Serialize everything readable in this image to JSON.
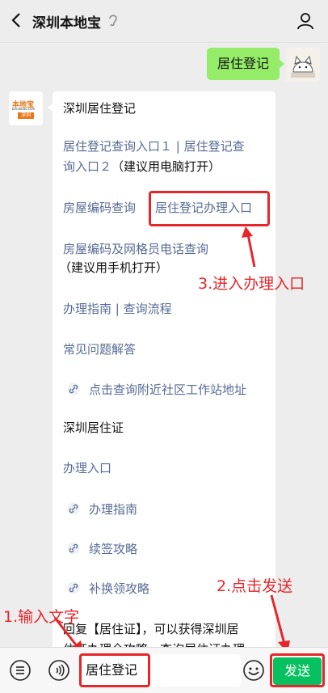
{
  "header": {
    "title": "深圳本地宝"
  },
  "user_message": "居住登记",
  "bot": {
    "logo_title": "本地宝",
    "logo_domain": "bendibao.com",
    "logo_city": "深圳",
    "heading": "深圳居住登记",
    "link1_line1": "居住登记查询入口１ | 居住登记查",
    "link1_line2a": "询入口２",
    "link1_line2b": "（建议用电脑打开）",
    "link2a": "房屋编码查询",
    "link2b": "居住登记办理入口",
    "link3_line1": "房屋编码及网格员电话查询",
    "link3_line2": "（建议用手机打开）",
    "link4": "办理指南 | 查询流程",
    "link5": "常见问题解答",
    "link6": "点击查询附近社区工作站地址",
    "heading2": "深圳居住证",
    "link7": "办理入口",
    "link8": "办理指南",
    "link9": "续签攻略",
    "link10": "补换领攻略",
    "reply_line1": "回复【居住证】，可以获得深圳居",
    "reply_line2": "住证办理全攻略，查询居住证办理"
  },
  "annotations": {
    "step1": "1.输入文字",
    "step2": "2.点击发送",
    "step3": "3.进入办理入口"
  },
  "input_bar": {
    "text": "居住登记",
    "send": "发送"
  },
  "colors": {
    "link": "#576b95",
    "callout": "#e6262b",
    "send": "#07c160",
    "user_bubble": "#95ec69"
  }
}
